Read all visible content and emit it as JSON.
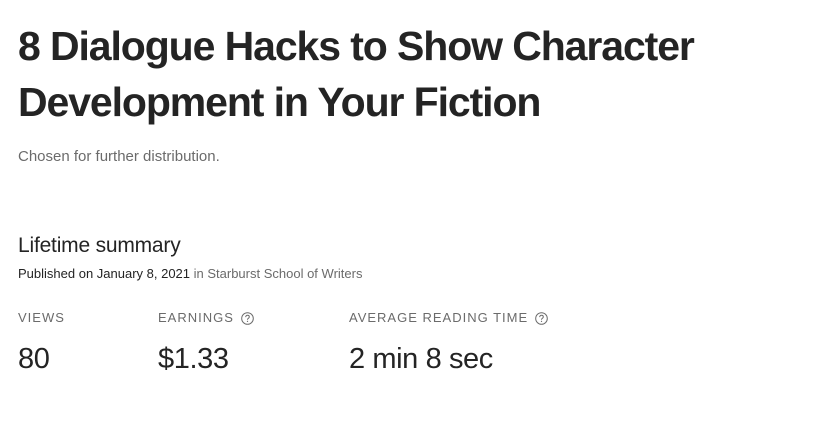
{
  "story": {
    "title": "8 Dialogue Hacks to Show Character Development in Your Fiction",
    "distribution_note": "Chosen for further distribution."
  },
  "summary": {
    "heading": "Lifetime summary",
    "published_prefix": "Published on January 8, 2021",
    "published_in_word": " in ",
    "publication": "Starburst School of Writers"
  },
  "stats": {
    "views": {
      "label": "VIEWS",
      "value": "80"
    },
    "earnings": {
      "label": "EARNINGS",
      "value": "$1.33",
      "icon": "help-circle-icon"
    },
    "reading_time": {
      "label": "AVERAGE READING TIME",
      "value": "2 min 8 sec",
      "icon": "help-circle-icon"
    }
  },
  "colors": {
    "text_primary": "#242424",
    "text_secondary": "#6b6b6b"
  }
}
